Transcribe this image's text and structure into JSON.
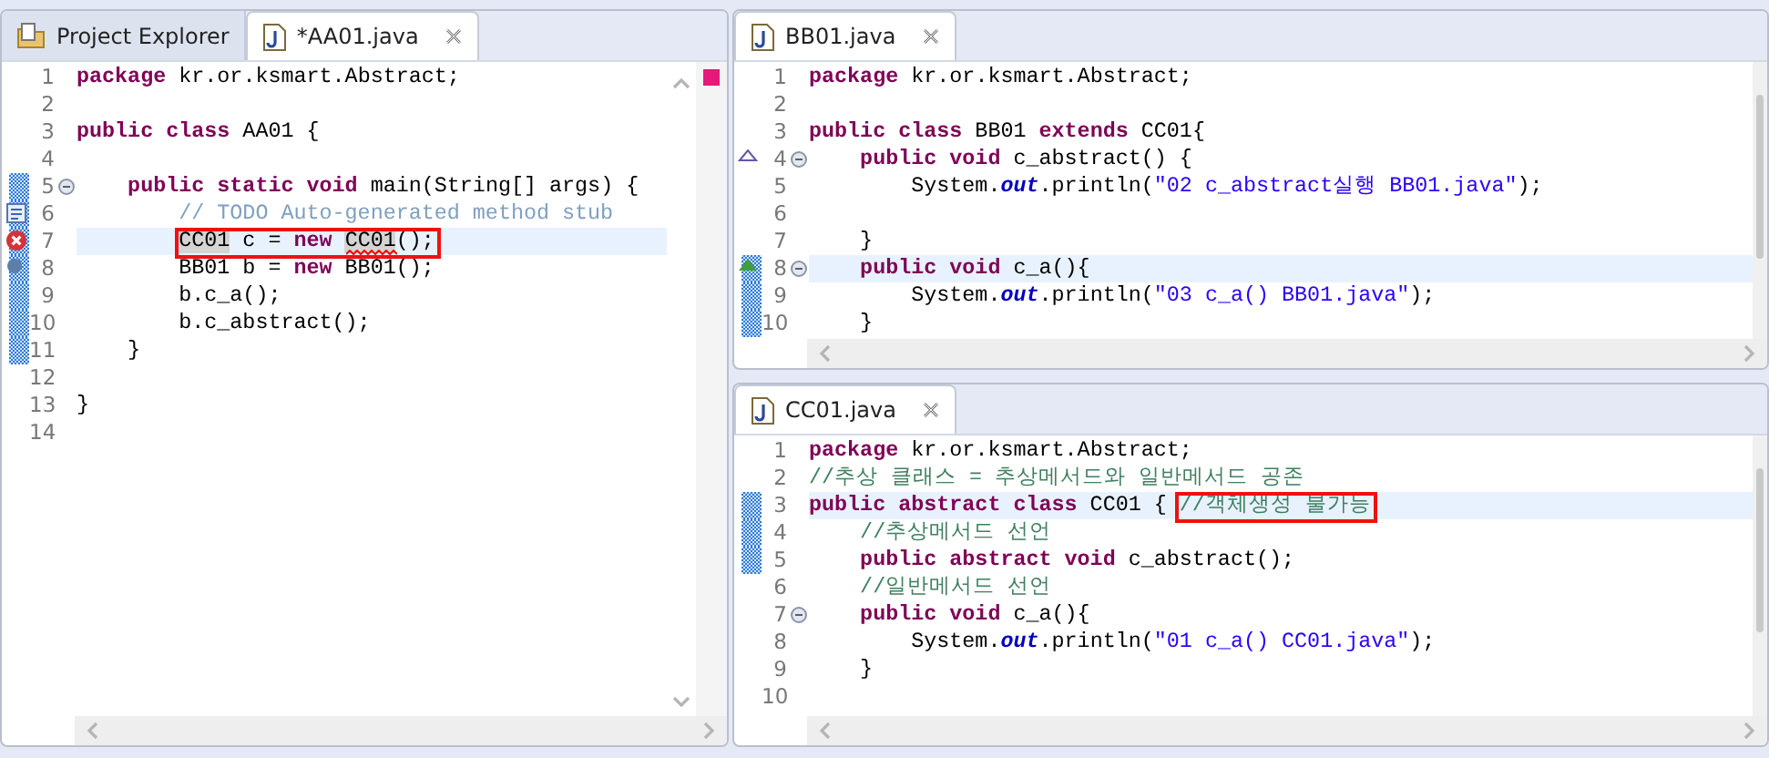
{
  "panes": [
    {
      "problems": true,
      "tabs": [
        {
          "label": "Project Explorer",
          "kind": "view",
          "selected": false
        },
        {
          "label": "*AA01.java",
          "kind": "file",
          "selected": true
        }
      ],
      "lines": [
        {
          "number": "1",
          "tokens": [
            {
              "kind": "keyword",
              "text": "package"
            },
            {
              "kind": "plain",
              "text": " kr.or.ksmart.Abstract;"
            }
          ]
        },
        {
          "number": "2"
        },
        {
          "number": "3",
          "tokens": [
            {
              "kind": "keyword",
              "text": "public class"
            },
            {
              "kind": "plain",
              "text": " AA01 {"
            }
          ]
        },
        {
          "number": "4"
        },
        {
          "number": "5",
          "changed": true,
          "fold": true,
          "tokens": [
            {
              "kind": "keyword",
              "text": "    public static void"
            },
            {
              "kind": "plain",
              "text": " main(String[] args) {"
            }
          ]
        },
        {
          "number": "6",
          "changed": true,
          "marker": {
            "kind": "task"
          },
          "tokens": [
            {
              "kind": "task-comment",
              "text": "        // TODO Auto-generated method stub"
            }
          ]
        },
        {
          "number": "7",
          "changed": true,
          "marker": {
            "kind": "error"
          },
          "current": true,
          "tokens": [
            {
              "kind": "occurrence",
              "text": "        CC01",
              "boxed": true
            },
            {
              "kind": "plain",
              "text": " c = ",
              "boxed": true
            },
            {
              "kind": "keyword",
              "text": "new ",
              "boxed": true
            },
            {
              "kind": "error-occurrence",
              "text": "CC01",
              "boxed": true
            },
            {
              "kind": "plain",
              "text": "();",
              "boxed": true
            }
          ]
        },
        {
          "number": "8",
          "changed": true,
          "marker": {
            "kind": "occurrence"
          },
          "tokens": [
            {
              "kind": "plain",
              "text": "        BB01 b = "
            },
            {
              "kind": "keyword",
              "text": "new"
            },
            {
              "kind": "plain",
              "text": " BB01();"
            }
          ]
        },
        {
          "number": "9",
          "changed": true,
          "tokens": [
            {
              "kind": "plain",
              "text": "        b.c_a();"
            }
          ]
        },
        {
          "number": "10",
          "changed": true,
          "tokens": [
            {
              "kind": "plain",
              "text": "        b.c_abstract();"
            }
          ]
        },
        {
          "number": "11",
          "changed": true,
          "tokens": [
            {
              "kind": "plain",
              "text": "    }"
            }
          ]
        },
        {
          "number": "12"
        },
        {
          "number": "13",
          "tokens": [
            {
              "kind": "plain",
              "text": "}"
            }
          ]
        },
        {
          "number": "14"
        }
      ]
    },
    {
      "problems": false,
      "tabs": [
        {
          "label": "BB01.java",
          "kind": "file",
          "selected": true
        }
      ],
      "lines": [
        {
          "number": "1",
          "tokens": [
            {
              "kind": "keyword",
              "text": "package"
            },
            {
              "kind": "plain",
              "text": " kr.or.ksmart.Abstract;"
            }
          ]
        },
        {
          "number": "2"
        },
        {
          "number": "3",
          "tokens": [
            {
              "kind": "keyword",
              "text": "public class"
            },
            {
              "kind": "plain",
              "text": " BB01 "
            },
            {
              "kind": "keyword",
              "text": "extends"
            },
            {
              "kind": "plain",
              "text": " CC01{"
            }
          ]
        },
        {
          "number": "4",
          "fold": true,
          "marker": {
            "kind": "implements"
          },
          "tokens": [
            {
              "kind": "keyword",
              "text": "    public void"
            },
            {
              "kind": "plain",
              "text": " c_abstract() {"
            }
          ]
        },
        {
          "number": "5",
          "tokens": [
            {
              "kind": "plain",
              "text": "        System."
            },
            {
              "kind": "static",
              "text": "out"
            },
            {
              "kind": "plain",
              "text": ".println("
            },
            {
              "kind": "string",
              "text": "\"02 c_abstract실행 BB01.java\""
            },
            {
              "kind": "plain",
              "text": ");"
            }
          ]
        },
        {
          "number": "6"
        },
        {
          "number": "7",
          "tokens": [
            {
              "kind": "plain",
              "text": "    }"
            }
          ]
        },
        {
          "number": "8",
          "changed": true,
          "fold": true,
          "current": true,
          "marker": {
            "kind": "overrides"
          },
          "tokens": [
            {
              "kind": "keyword",
              "text": "    public void"
            },
            {
              "kind": "plain",
              "text": " c_a(){"
            }
          ]
        },
        {
          "number": "9",
          "changed": true,
          "tokens": [
            {
              "kind": "plain",
              "text": "        System."
            },
            {
              "kind": "static",
              "text": "out"
            },
            {
              "kind": "plain",
              "text": ".println("
            },
            {
              "kind": "string",
              "text": "\"03 c_a() BB01.java\""
            },
            {
              "kind": "plain",
              "text": ");"
            }
          ]
        },
        {
          "number": "10",
          "changed": true,
          "tokens": [
            {
              "kind": "plain",
              "text": "    }"
            }
          ]
        }
      ]
    },
    {
      "problems": false,
      "tabs": [
        {
          "label": "CC01.java",
          "kind": "file",
          "selected": true
        }
      ],
      "lines": [
        {
          "number": "1",
          "tokens": [
            {
              "kind": "keyword",
              "text": "package"
            },
            {
              "kind": "plain",
              "text": " kr.or.ksmart.Abstract;"
            }
          ]
        },
        {
          "number": "2",
          "tokens": [
            {
              "kind": "comment",
              "text": "//추상 클래스 = 추상메서드와 일반메서드 공존"
            }
          ]
        },
        {
          "number": "3",
          "changed": true,
          "current": true,
          "tokens": [
            {
              "kind": "keyword",
              "text": "public abstract class"
            },
            {
              "kind": "plain",
              "text": " CC01 { "
            },
            {
              "kind": "comment",
              "text": "//객체생성 불가능",
              "boxed": true
            }
          ]
        },
        {
          "number": "4",
          "changed": true,
          "tokens": [
            {
              "kind": "comment",
              "text": "    //추상메서드 선언"
            }
          ]
        },
        {
          "number": "5",
          "changed": true,
          "tokens": [
            {
              "kind": "keyword",
              "text": "    public abstract void"
            },
            {
              "kind": "plain",
              "text": " c_abstract();"
            }
          ]
        },
        {
          "number": "6",
          "tokens": [
            {
              "kind": "comment",
              "text": "    //일반메서드 선언"
            }
          ]
        },
        {
          "number": "7",
          "fold": true,
          "tokens": [
            {
              "kind": "keyword",
              "text": "    public void"
            },
            {
              "kind": "plain",
              "text": " c_a(){"
            }
          ]
        },
        {
          "number": "8",
          "tokens": [
            {
              "kind": "plain",
              "text": "        System."
            },
            {
              "kind": "static",
              "text": "out"
            },
            {
              "kind": "plain",
              "text": ".println("
            },
            {
              "kind": "string",
              "text": "\"01 c_a() CC01.java\""
            },
            {
              "kind": "plain",
              "text": ");"
            }
          ]
        },
        {
          "number": "9",
          "tokens": [
            {
              "kind": "plain",
              "text": "    }"
            }
          ]
        },
        {
          "number": "10"
        }
      ]
    }
  ]
}
